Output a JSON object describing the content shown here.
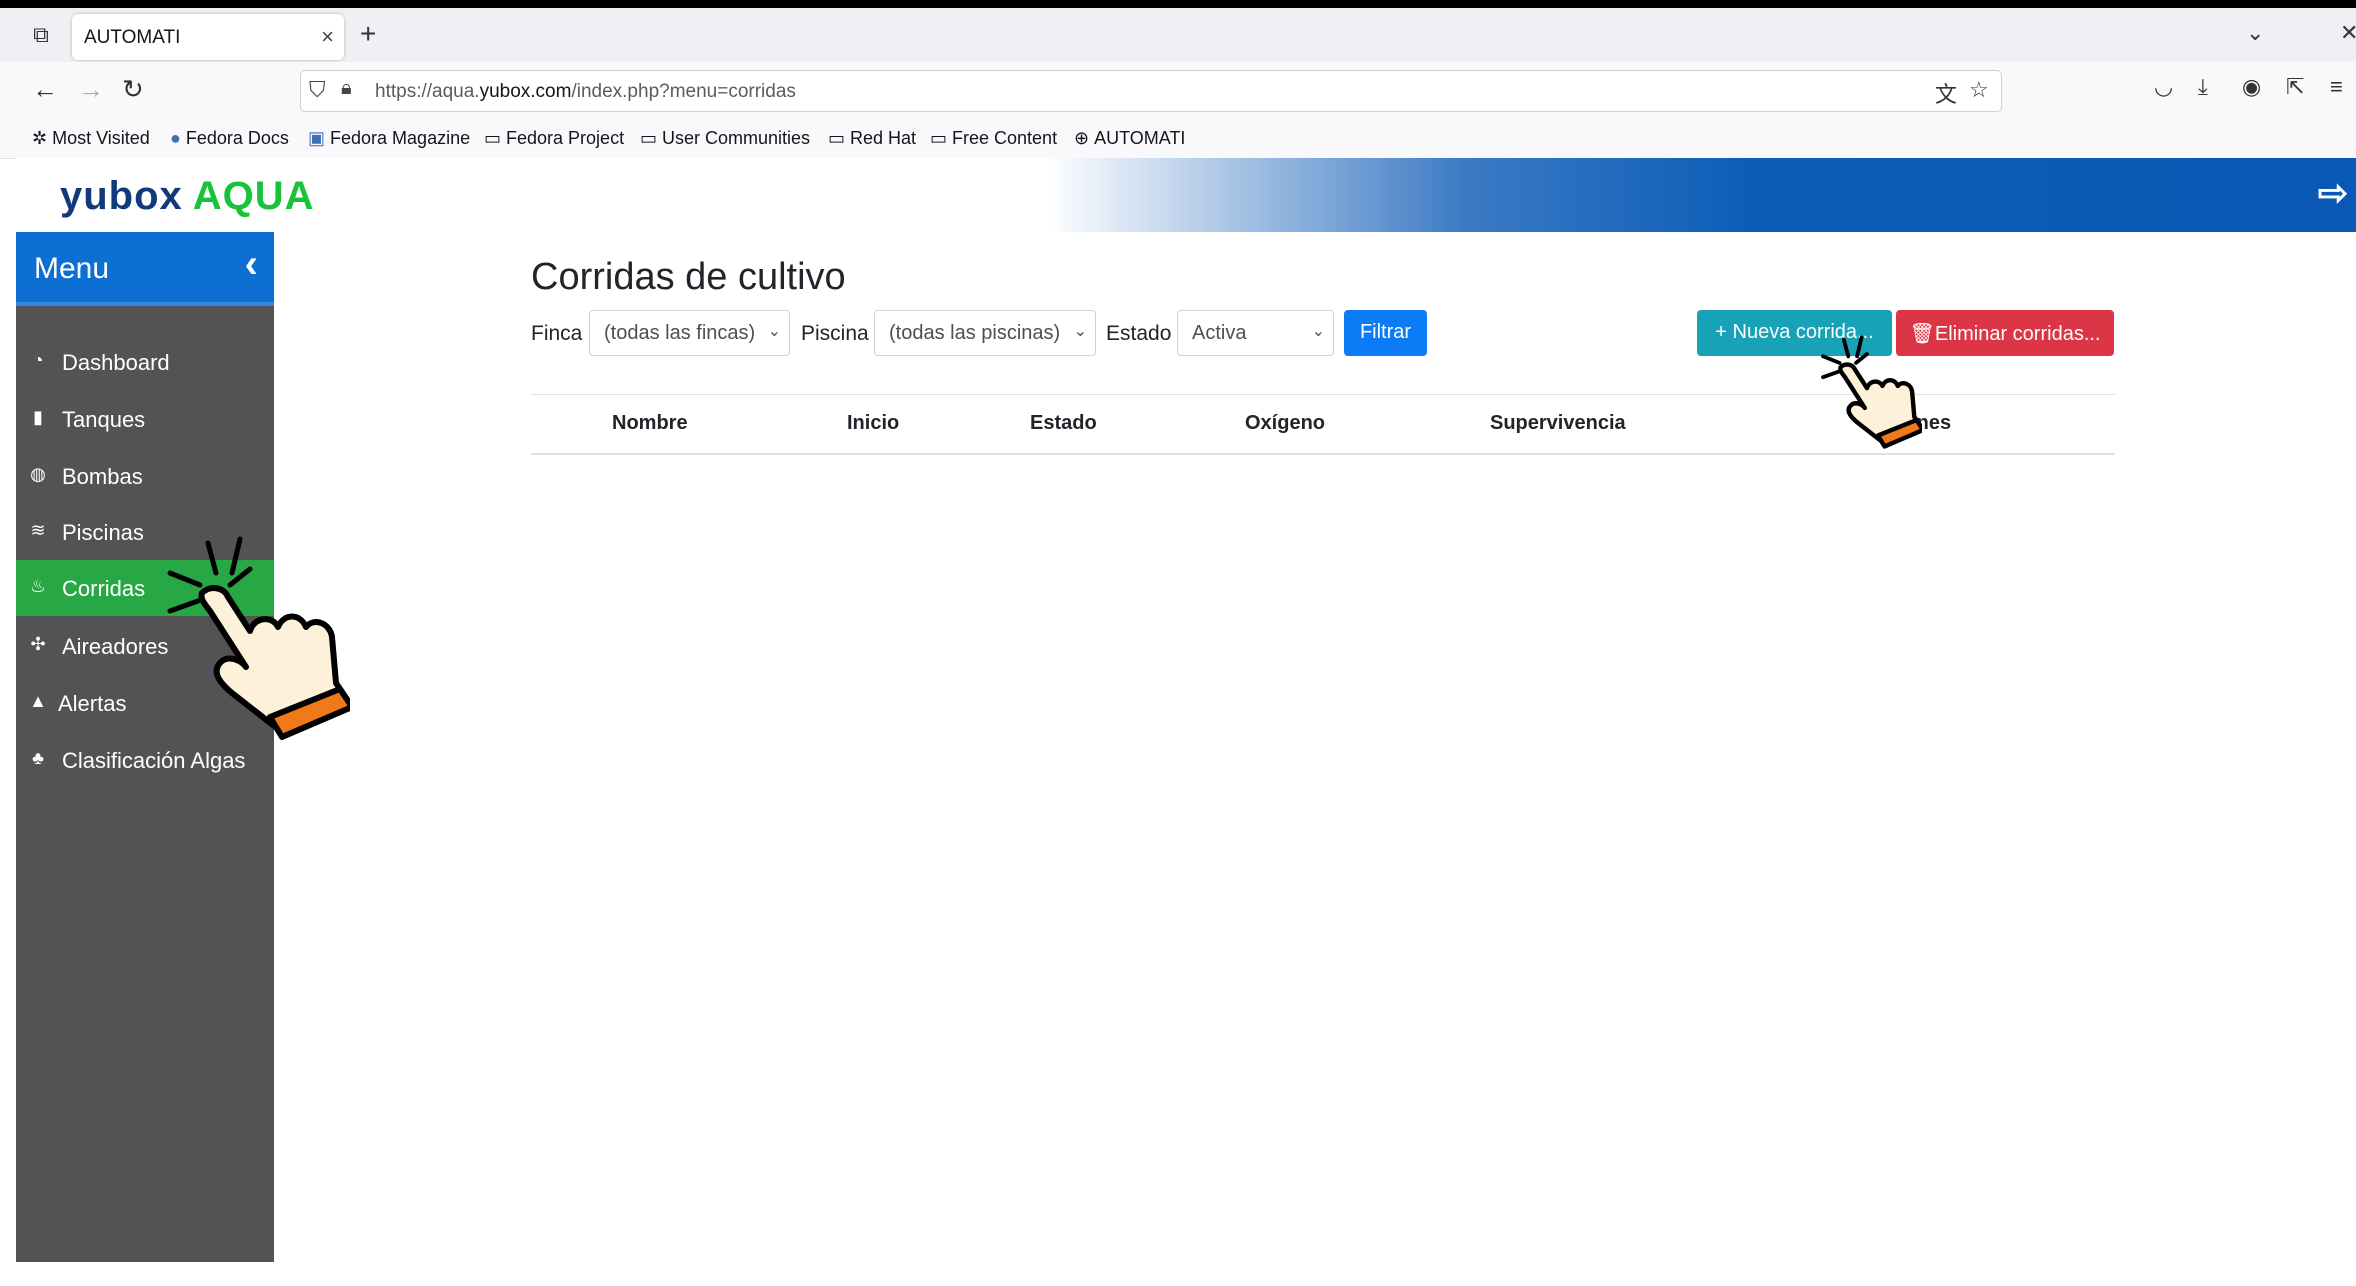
{
  "browser": {
    "tab_title": "AUTOMATI",
    "tab_close": "×",
    "new_tab": "+",
    "url_host_pre": "https://aqua.",
    "url_host": "yubox.com",
    "url_path": "/index.php?menu=corridas",
    "bookmarks": [
      {
        "icon": "gear-icon",
        "label": "Most Visited"
      },
      {
        "icon": "fedora-icon",
        "label": "Fedora Docs"
      },
      {
        "icon": "magazine-icon",
        "label": "Fedora Magazine"
      },
      {
        "icon": "folder-icon",
        "label": "Fedora Project"
      },
      {
        "icon": "folder-icon",
        "label": "User Communities"
      },
      {
        "icon": "folder-icon",
        "label": "Red Hat"
      },
      {
        "icon": "folder-icon",
        "label": "Free Content"
      },
      {
        "icon": "globe-icon",
        "label": "AUTOMATI"
      }
    ]
  },
  "app": {
    "logo_left": "yubox",
    "logo_right": "AQUA"
  },
  "sidebar": {
    "title": "Menu",
    "items": [
      {
        "label": "Dashboard",
        "icon": "dashboard-icon"
      },
      {
        "label": "Tanques",
        "icon": "tank-icon"
      },
      {
        "label": "Bombas",
        "icon": "pump-icon"
      },
      {
        "label": "Piscinas",
        "icon": "water-icon"
      },
      {
        "label": "Corridas",
        "icon": "shrimp-icon",
        "active": true
      },
      {
        "label": "Aireadores",
        "icon": "fan-icon"
      },
      {
        "label": "Alertas",
        "icon": "bell-icon"
      },
      {
        "label": "Clasificación Algas",
        "icon": "algae-icon"
      }
    ]
  },
  "main": {
    "title": "Corridas de cultivo",
    "filters": {
      "finca_label": "Finca",
      "finca_value": "(todas las fincas)",
      "piscina_label": "Piscina",
      "piscina_value": "(todas las piscinas)",
      "estado_label": "Estado",
      "estado_value": "Activa",
      "filter_button": "Filtrar"
    },
    "new_button": "+ Nueva corrida...",
    "delete_button": "Eliminar corridas...",
    "table_headers": [
      "Nombre",
      "Inicio",
      "Estado",
      "Oxígeno",
      "Supervivencia",
      "Opciones"
    ]
  },
  "colors": {
    "menu_header": "#0d6fd1",
    "active_item": "#28a745",
    "new_button": "#17a2b8",
    "delete_button": "#dc3545",
    "filter_button": "#0b7cf5"
  }
}
